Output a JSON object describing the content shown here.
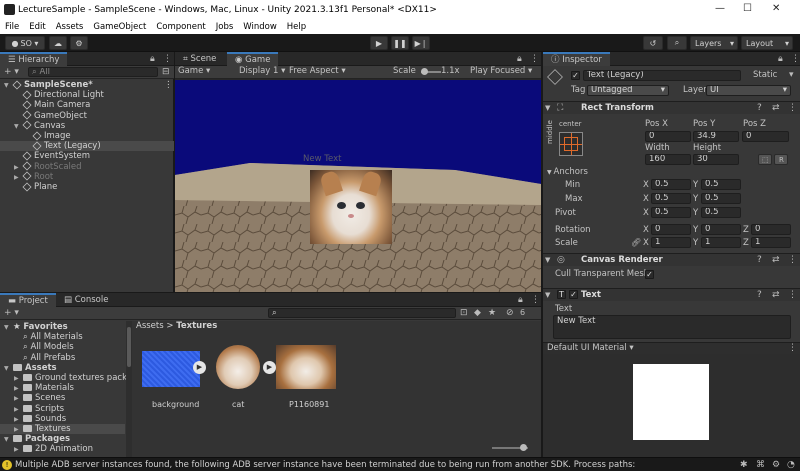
{
  "window": {
    "title": "LectureSample - SampleScene - Windows, Mac, Linux - Unity 2021.3.13f1 Personal* <DX11>",
    "minimize": "—",
    "maximize": "☐",
    "close": "✕"
  },
  "menu": [
    "File",
    "Edit",
    "Assets",
    "GameObject",
    "Component",
    "Jobs",
    "Window",
    "Help"
  ],
  "toolbar": {
    "account_label": "SO ▾",
    "layers_label": "Layers",
    "layout_label": "Layout"
  },
  "hierarchy": {
    "tab_label": "Hierarchy",
    "search_placeholder": "All",
    "add_label": "+ ▾",
    "items": [
      {
        "label": "SampleScene*",
        "depth": 0,
        "kind": "scene"
      },
      {
        "label": "Directional Light",
        "depth": 1,
        "kind": "object"
      },
      {
        "label": "Main Camera",
        "depth": 1,
        "kind": "object"
      },
      {
        "label": "GameObject",
        "depth": 1,
        "kind": "object"
      },
      {
        "label": "Canvas",
        "depth": 1,
        "kind": "object"
      },
      {
        "label": "Image",
        "depth": 2,
        "kind": "object"
      },
      {
        "label": "Text (Legacy)",
        "depth": 2,
        "kind": "object",
        "selected": true
      },
      {
        "label": "EventSystem",
        "depth": 1,
        "kind": "object"
      },
      {
        "label": "RootScaled",
        "depth": 1,
        "kind": "object",
        "dim": true
      },
      {
        "label": "Root",
        "depth": 1,
        "kind": "object",
        "dim": true
      },
      {
        "label": "Plane",
        "depth": 1,
        "kind": "object"
      }
    ]
  },
  "scene_view": {
    "scene_tab": "Scene",
    "game_tab": "Game",
    "game_dropdown": "Game ▾",
    "display": "Display 1 ▾",
    "aspect": "Free Aspect ▾",
    "scale_label": "Scale",
    "scale_value": "1.1x",
    "play_mode": "Play Focused ▾",
    "overlay_text": "New Text"
  },
  "project": {
    "project_tab": "Project",
    "console_tab": "Console",
    "breadcrumb_assets": "Assets",
    "breadcrumb_sep": ">",
    "breadcrumb_current": "Textures",
    "badge_count": "6",
    "tree": [
      {
        "label": "Favorites",
        "depth": 0,
        "kind": "star",
        "bold": true
      },
      {
        "label": "All Materials",
        "depth": 1,
        "kind": "search"
      },
      {
        "label": "All Models",
        "depth": 1,
        "kind": "search"
      },
      {
        "label": "All Prefabs",
        "depth": 1,
        "kind": "search"
      },
      {
        "label": "Assets",
        "depth": 0,
        "kind": "folder",
        "bold": true
      },
      {
        "label": "Ground textures pack",
        "depth": 1,
        "kind": "folder"
      },
      {
        "label": "Materials",
        "depth": 1,
        "kind": "folder"
      },
      {
        "label": "Scenes",
        "depth": 1,
        "kind": "folder"
      },
      {
        "label": "Scripts",
        "depth": 1,
        "kind": "folder"
      },
      {
        "label": "Sounds",
        "depth": 1,
        "kind": "folder"
      },
      {
        "label": "Textures",
        "depth": 1,
        "kind": "folder",
        "selected": true
      },
      {
        "label": "Packages",
        "depth": 0,
        "kind": "folder",
        "bold": true
      },
      {
        "label": "2D Animation",
        "depth": 1,
        "kind": "folder"
      }
    ],
    "assets": [
      {
        "name": "background",
        "thumb": "blue-texture"
      },
      {
        "name": "cat",
        "thumb": "cat-face"
      },
      {
        "name": "P1160891",
        "thumb": "cat-photo"
      }
    ]
  },
  "inspector": {
    "tab_label": "Inspector",
    "object_name": "Text (Legacy)",
    "static_label": "Static",
    "tag_label": "Tag",
    "tag_value": "Untagged",
    "layer_label": "Layer",
    "layer_value": "UI",
    "rect_transform": {
      "title": "Rect Transform",
      "anchor_h": "center",
      "anchor_v": "middle",
      "pos_x_label": "Pos X",
      "pos_y_label": "Pos Y",
      "pos_z_label": "Pos Z",
      "pos_x": "0",
      "pos_y": "34.9",
      "pos_z": "0",
      "width_label": "Width",
      "height_label": "Height",
      "width": "160",
      "height": "30",
      "r_label": "R",
      "anchors_label": "Anchors",
      "min_label": "Min",
      "max_label": "Max",
      "pivot_label": "Pivot",
      "x_label": "X",
      "y_label": "Y",
      "z_label": "Z",
      "min_x": "0.5",
      "min_y": "0.5",
      "max_x": "0.5",
      "max_y": "0.5",
      "pivot_x": "0.5",
      "pivot_y": "0.5",
      "rotation_label": "Rotation",
      "rot_x": "0",
      "rot_y": "0",
      "rot_z": "0",
      "scale_label": "Scale",
      "scale_x": "1",
      "scale_y": "1",
      "scale_z": "1"
    },
    "canvas_renderer": {
      "title": "Canvas Renderer",
      "cull_label": "Cull Transparent Mesh"
    },
    "text_component": {
      "title": "Text",
      "text_label": "Text",
      "text_value": "New Text"
    },
    "material_label": "Default UI Material ▾"
  },
  "status": {
    "message": "Multiple ADB server instances found, the following ADB server instance have been terminated due to being run from another SDK. Process paths:"
  },
  "colors": {
    "accent": "#3a79bb",
    "selection": "#2c5d87",
    "game_sky": "#0a0a7a",
    "panel": "#383838"
  }
}
